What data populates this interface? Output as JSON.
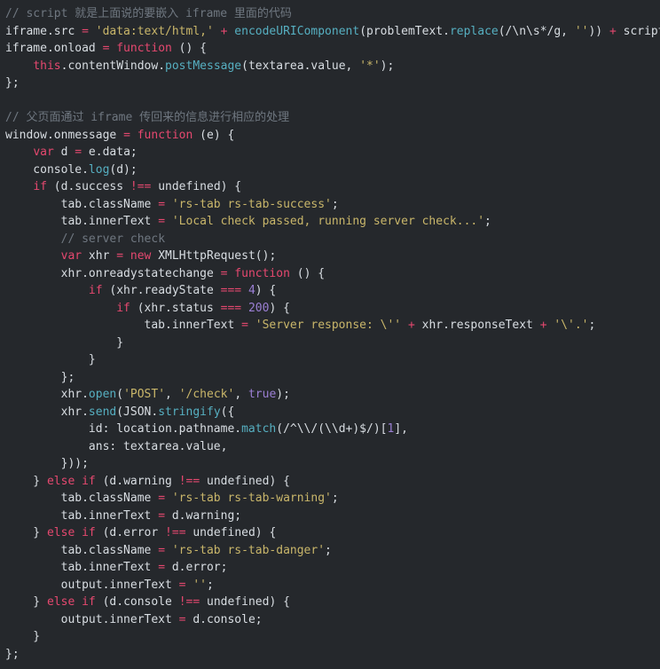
{
  "editor": {
    "language": "javascript",
    "background": "#25282c",
    "foreground": "#d8dde2",
    "indent_size": 4,
    "font_size_px": 13,
    "line_height_px": 19.5,
    "theme_colors": {
      "comment": "#6f7780",
      "keyword": "#e5486f",
      "string": "#c9b66a",
      "function": "#56afc1",
      "number": "#9b7fd4",
      "operator": "#e5486f",
      "plain": "#d8dde2"
    }
  },
  "lines": [
    [
      {
        "t": "// script 就是上面说的要嵌入 iframe 里面的代码",
        "c": "cmt"
      }
    ],
    [
      {
        "t": "iframe.src ",
        "c": "pln"
      },
      {
        "t": "=",
        "c": "op"
      },
      {
        "t": " ",
        "c": "pln"
      },
      {
        "t": "'data:text/html,'",
        "c": "str"
      },
      {
        "t": " ",
        "c": "pln"
      },
      {
        "t": "+",
        "c": "op"
      },
      {
        "t": " ",
        "c": "pln"
      },
      {
        "t": "encodeURIComponent",
        "c": "fn"
      },
      {
        "t": "(problemText.",
        "c": "pln"
      },
      {
        "t": "replace",
        "c": "fn"
      },
      {
        "t": "(/\\n\\s*/g, ",
        "c": "pln"
      },
      {
        "t": "''",
        "c": "str"
      },
      {
        "t": ")) ",
        "c": "pln"
      },
      {
        "t": "+",
        "c": "op"
      },
      {
        "t": " script;",
        "c": "pln"
      }
    ],
    [
      {
        "t": "iframe.onload ",
        "c": "pln"
      },
      {
        "t": "=",
        "c": "op"
      },
      {
        "t": " ",
        "c": "pln"
      },
      {
        "t": "function",
        "c": "kw"
      },
      {
        "t": " () {",
        "c": "pln"
      }
    ],
    [
      {
        "t": "    ",
        "c": "pln"
      },
      {
        "t": "this",
        "c": "kw"
      },
      {
        "t": ".contentWindow.",
        "c": "pln"
      },
      {
        "t": "postMessage",
        "c": "fn"
      },
      {
        "t": "(textarea.value, ",
        "c": "pln"
      },
      {
        "t": "'*'",
        "c": "str"
      },
      {
        "t": ");",
        "c": "pln"
      }
    ],
    [
      {
        "t": "};",
        "c": "pln"
      }
    ],
    [
      {
        "t": "",
        "c": "pln"
      }
    ],
    [
      {
        "t": "// 父页面通过 iframe 传回来的信息进行相应的处理",
        "c": "cmt"
      }
    ],
    [
      {
        "t": "window.onmessage ",
        "c": "pln"
      },
      {
        "t": "=",
        "c": "op"
      },
      {
        "t": " ",
        "c": "pln"
      },
      {
        "t": "function",
        "c": "kw"
      },
      {
        "t": " (e) {",
        "c": "pln"
      }
    ],
    [
      {
        "t": "    ",
        "c": "pln"
      },
      {
        "t": "var",
        "c": "kw"
      },
      {
        "t": " d ",
        "c": "pln"
      },
      {
        "t": "=",
        "c": "op"
      },
      {
        "t": " e.data;",
        "c": "pln"
      }
    ],
    [
      {
        "t": "    console.",
        "c": "pln"
      },
      {
        "t": "log",
        "c": "fn"
      },
      {
        "t": "(d);",
        "c": "pln"
      }
    ],
    [
      {
        "t": "    ",
        "c": "pln"
      },
      {
        "t": "if",
        "c": "kw"
      },
      {
        "t": " (d.success ",
        "c": "pln"
      },
      {
        "t": "!==",
        "c": "op"
      },
      {
        "t": " undefined) {",
        "c": "pln"
      }
    ],
    [
      {
        "t": "        tab.className ",
        "c": "pln"
      },
      {
        "t": "=",
        "c": "op"
      },
      {
        "t": " ",
        "c": "pln"
      },
      {
        "t": "'rs-tab rs-tab-success'",
        "c": "str"
      },
      {
        "t": ";",
        "c": "pln"
      }
    ],
    [
      {
        "t": "        tab.innerText ",
        "c": "pln"
      },
      {
        "t": "=",
        "c": "op"
      },
      {
        "t": " ",
        "c": "pln"
      },
      {
        "t": "'Local check passed, running server check...'",
        "c": "str"
      },
      {
        "t": ";",
        "c": "pln"
      }
    ],
    [
      {
        "t": "        ",
        "c": "pln"
      },
      {
        "t": "// server check",
        "c": "cmt"
      }
    ],
    [
      {
        "t": "        ",
        "c": "pln"
      },
      {
        "t": "var",
        "c": "kw"
      },
      {
        "t": " xhr ",
        "c": "pln"
      },
      {
        "t": "=",
        "c": "op"
      },
      {
        "t": " ",
        "c": "pln"
      },
      {
        "t": "new",
        "c": "kw"
      },
      {
        "t": " XMLHttpRequest();",
        "c": "pln"
      }
    ],
    [
      {
        "t": "        xhr.onreadystatechange ",
        "c": "pln"
      },
      {
        "t": "=",
        "c": "op"
      },
      {
        "t": " ",
        "c": "pln"
      },
      {
        "t": "function",
        "c": "kw"
      },
      {
        "t": " () {",
        "c": "pln"
      }
    ],
    [
      {
        "t": "            ",
        "c": "pln"
      },
      {
        "t": "if",
        "c": "kw"
      },
      {
        "t": " (xhr.readyState ",
        "c": "pln"
      },
      {
        "t": "===",
        "c": "op"
      },
      {
        "t": " ",
        "c": "pln"
      },
      {
        "t": "4",
        "c": "num"
      },
      {
        "t": ") {",
        "c": "pln"
      }
    ],
    [
      {
        "t": "                ",
        "c": "pln"
      },
      {
        "t": "if",
        "c": "kw"
      },
      {
        "t": " (xhr.status ",
        "c": "pln"
      },
      {
        "t": "===",
        "c": "op"
      },
      {
        "t": " ",
        "c": "pln"
      },
      {
        "t": "200",
        "c": "num"
      },
      {
        "t": ") {",
        "c": "pln"
      }
    ],
    [
      {
        "t": "                    tab.innerText ",
        "c": "pln"
      },
      {
        "t": "=",
        "c": "op"
      },
      {
        "t": " ",
        "c": "pln"
      },
      {
        "t": "'Server response: \\''",
        "c": "str"
      },
      {
        "t": " ",
        "c": "pln"
      },
      {
        "t": "+",
        "c": "op"
      },
      {
        "t": " xhr.responseText ",
        "c": "pln"
      },
      {
        "t": "+",
        "c": "op"
      },
      {
        "t": " ",
        "c": "pln"
      },
      {
        "t": "'\\'.'",
        "c": "str"
      },
      {
        "t": ";",
        "c": "pln"
      }
    ],
    [
      {
        "t": "                }",
        "c": "pln"
      }
    ],
    [
      {
        "t": "            }",
        "c": "pln"
      }
    ],
    [
      {
        "t": "        };",
        "c": "pln"
      }
    ],
    [
      {
        "t": "        xhr.",
        "c": "pln"
      },
      {
        "t": "open",
        "c": "fn"
      },
      {
        "t": "(",
        "c": "pln"
      },
      {
        "t": "'POST'",
        "c": "str"
      },
      {
        "t": ", ",
        "c": "pln"
      },
      {
        "t": "'/check'",
        "c": "str"
      },
      {
        "t": ", ",
        "c": "pln"
      },
      {
        "t": "true",
        "c": "num"
      },
      {
        "t": ");",
        "c": "pln"
      }
    ],
    [
      {
        "t": "        xhr.",
        "c": "pln"
      },
      {
        "t": "send",
        "c": "fn"
      },
      {
        "t": "(JSON.",
        "c": "pln"
      },
      {
        "t": "stringify",
        "c": "fn"
      },
      {
        "t": "({",
        "c": "pln"
      }
    ],
    [
      {
        "t": "            id: location.pathname.",
        "c": "pln"
      },
      {
        "t": "match",
        "c": "fn"
      },
      {
        "t": "(/^\\\\/(\\\\d+)$/)[",
        "c": "pln"
      },
      {
        "t": "1",
        "c": "num"
      },
      {
        "t": "],",
        "c": "pln"
      }
    ],
    [
      {
        "t": "            ans: textarea.value,",
        "c": "pln"
      }
    ],
    [
      {
        "t": "        }));",
        "c": "pln"
      }
    ],
    [
      {
        "t": "    } ",
        "c": "pln"
      },
      {
        "t": "else",
        "c": "kw"
      },
      {
        "t": " ",
        "c": "pln"
      },
      {
        "t": "if",
        "c": "kw"
      },
      {
        "t": " (d.warning ",
        "c": "pln"
      },
      {
        "t": "!==",
        "c": "op"
      },
      {
        "t": " undefined) {",
        "c": "pln"
      }
    ],
    [
      {
        "t": "        tab.className ",
        "c": "pln"
      },
      {
        "t": "=",
        "c": "op"
      },
      {
        "t": " ",
        "c": "pln"
      },
      {
        "t": "'rs-tab rs-tab-warning'",
        "c": "str"
      },
      {
        "t": ";",
        "c": "pln"
      }
    ],
    [
      {
        "t": "        tab.innerText ",
        "c": "pln"
      },
      {
        "t": "=",
        "c": "op"
      },
      {
        "t": " d.warning;",
        "c": "pln"
      }
    ],
    [
      {
        "t": "    } ",
        "c": "pln"
      },
      {
        "t": "else",
        "c": "kw"
      },
      {
        "t": " ",
        "c": "pln"
      },
      {
        "t": "if",
        "c": "kw"
      },
      {
        "t": " (d.error ",
        "c": "pln"
      },
      {
        "t": "!==",
        "c": "op"
      },
      {
        "t": " undefined) {",
        "c": "pln"
      }
    ],
    [
      {
        "t": "        tab.className ",
        "c": "pln"
      },
      {
        "t": "=",
        "c": "op"
      },
      {
        "t": " ",
        "c": "pln"
      },
      {
        "t": "'rs-tab rs-tab-danger'",
        "c": "str"
      },
      {
        "t": ";",
        "c": "pln"
      }
    ],
    [
      {
        "t": "        tab.innerText ",
        "c": "pln"
      },
      {
        "t": "=",
        "c": "op"
      },
      {
        "t": " d.error;",
        "c": "pln"
      }
    ],
    [
      {
        "t": "        output.innerText ",
        "c": "pln"
      },
      {
        "t": "=",
        "c": "op"
      },
      {
        "t": " ",
        "c": "pln"
      },
      {
        "t": "''",
        "c": "str"
      },
      {
        "t": ";",
        "c": "pln"
      }
    ],
    [
      {
        "t": "    } ",
        "c": "pln"
      },
      {
        "t": "else",
        "c": "kw"
      },
      {
        "t": " ",
        "c": "pln"
      },
      {
        "t": "if",
        "c": "kw"
      },
      {
        "t": " (d.console ",
        "c": "pln"
      },
      {
        "t": "!==",
        "c": "op"
      },
      {
        "t": " undefined) {",
        "c": "pln"
      }
    ],
    [
      {
        "t": "        output.innerText ",
        "c": "pln"
      },
      {
        "t": "=",
        "c": "op"
      },
      {
        "t": " d.console;",
        "c": "pln"
      }
    ],
    [
      {
        "t": "    }",
        "c": "pln"
      }
    ],
    [
      {
        "t": "};",
        "c": "pln"
      }
    ]
  ]
}
